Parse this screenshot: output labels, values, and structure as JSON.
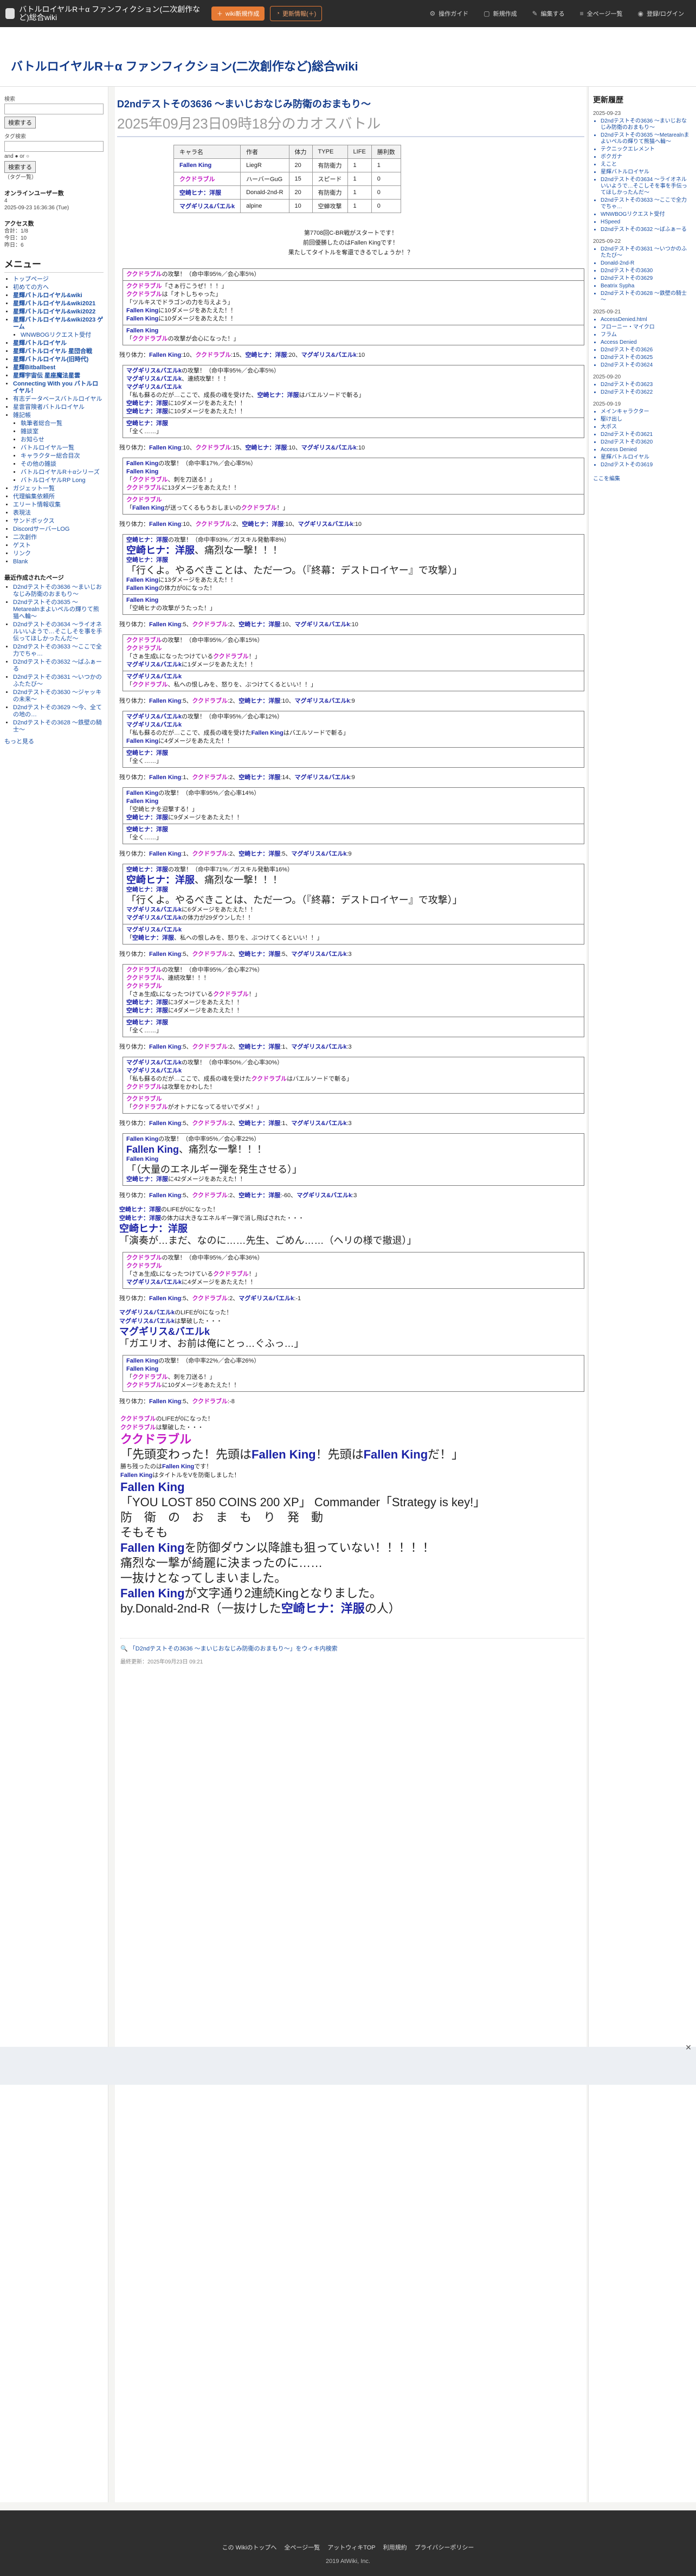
{
  "topbar": {
    "title": "バトルロイヤルR＋α ファンフィクション(二次創作など)総合wiki",
    "btn_wiki": "wiki新規作成",
    "btn_update": "更新情報(＋)",
    "menu": [
      {
        "icon": "gear-icon",
        "label": "操作ガイド"
      },
      {
        "icon": "file-icon",
        "label": "新規作成"
      },
      {
        "icon": "pencil-icon",
        "label": "編集する"
      },
      {
        "icon": "list-icon",
        "label": "全ページ一覧"
      },
      {
        "icon": "user-icon",
        "label": "登録/ログイン"
      }
    ]
  },
  "header": {
    "title": "バトルロイヤルR＋α ファンフィクション(二次創作など)総合wiki"
  },
  "left": {
    "search_label": "検索",
    "search_btn": "検索する",
    "search2_label": "タグ検索",
    "search2_hint": "and ● or ○",
    "search2_btn": "検索する",
    "tag_hint": "（タグ一覧）",
    "online_label": "オンラインユーザー数",
    "online_count": "4",
    "online_date": "2025-09-23 16:36:36 (Tue)",
    "access_label": "アクセス数",
    "access": [
      "合計：1/8",
      "今日：10",
      "昨日：6"
    ],
    "menu_title": "メニュー",
    "menu": [
      {
        "t": "トップページ",
        "b": false,
        "s": false
      },
      {
        "t": "初めての方へ",
        "b": false,
        "s": false
      },
      {
        "t": "星輝バトルロイヤル&wiki",
        "b": true,
        "s": false
      },
      {
        "t": "星輝バトルロイヤル&wiki2021",
        "b": true,
        "s": false
      },
      {
        "t": "星輝バトルロイヤル&wiki2022",
        "b": true,
        "s": false
      },
      {
        "t": "星輝バトルロイヤル&wiki2023 ゲーム",
        "b": true,
        "s": false
      },
      {
        "t": "WNWBOGリクエスト受付",
        "b": false,
        "s": true
      },
      {
        "t": "星輝バトルロイヤル",
        "b": true,
        "s": false
      },
      {
        "t": "星輝バトルロイヤル 星団合戦",
        "b": true,
        "s": false
      },
      {
        "t": "星輝バトルロイヤル(旧時代)",
        "b": true,
        "s": false
      },
      {
        "t": "星輝Bitballbest",
        "b": true,
        "s": false
      },
      {
        "t": "星輝宇宙伝 星座魔法星雲",
        "b": true,
        "s": false
      },
      {
        "t": "Connecting With you バトルロイヤル！",
        "b": true,
        "s": false
      },
      {
        "t": "有志データベースバトルロイヤル",
        "b": false,
        "s": false
      },
      {
        "t": "星雲冒険者バトルロイヤル",
        "b": false,
        "s": false
      },
      {
        "t": "雑記帳",
        "b": false,
        "s": false
      },
      {
        "t": "執筆者総合一覧",
        "b": false,
        "s": true
      },
      {
        "t": "雑談室",
        "b": false,
        "s": true
      },
      {
        "t": "お知らせ",
        "b": false,
        "s": true
      },
      {
        "t": "バトルロイヤル一覧",
        "b": false,
        "s": true
      },
      {
        "t": "キャラクター総合目次",
        "b": false,
        "s": true
      },
      {
        "t": "その他の雑談",
        "b": false,
        "s": true
      },
      {
        "t": "バトルロイヤルR＋αシリーズ",
        "b": false,
        "s": true
      },
      {
        "t": "バトルロイヤルRP Long",
        "b": false,
        "s": true
      },
      {
        "t": "ガジェット一覧",
        "b": false,
        "s": false
      },
      {
        "t": "代理編集依頼所",
        "b": false,
        "s": false
      },
      {
        "t": "エリート情報収集",
        "b": false,
        "s": false
      },
      {
        "t": "表現法",
        "b": false,
        "s": false
      },
      {
        "t": "サンドボックス",
        "b": false,
        "s": false
      },
      {
        "t": "DiscordサーバーLOG",
        "b": false,
        "s": false
      },
      {
        "t": "二次創作",
        "b": false,
        "s": false
      },
      {
        "t": "ゲスト",
        "b": false,
        "s": false
      },
      {
        "t": "リンク",
        "b": false,
        "s": false
      },
      {
        "t": "Blank",
        "b": false,
        "s": false
      }
    ],
    "recent_title": "最近作成されたページ",
    "recent": [
      "D2ndテストその3636 ～まいじおなじみ防衛のおまもり～",
      "D2ndテストその3635 ～Metarealnまよいペルの輝りて熊猫へ輪～",
      "D2ndテストその3634 ～ライオネルいいようで…そこしそを事を手伝ってほしかったんだ～",
      "D2ndテストその3633 ～ここで全力でちゃ…",
      "D2ndテストその3632 ～ばふぁーる",
      "D2ndテストその3631 ～いつかのふたたび～",
      "D2ndテストその3630 ～ジャッキの未来～",
      "D2ndテストその3629 ～今、全ての地の…",
      "D2ndテストその3628 ～鉄壁の騎士～"
    ],
    "more": "もっと見る"
  },
  "main": {
    "title": "D2ndテストその3636 ～まいじおなじみ防衛のおまもり～",
    "subtitle": "2025年09月23日09時18分のカオスバトル",
    "table_headers": [
      "キャラ名",
      "作者",
      "体力",
      "TYPE",
      "LIFE",
      "勝利数"
    ],
    "table_rows": [
      [
        "Fallen King",
        "LiegR",
        "20",
        "有防衛力",
        "1",
        "1"
      ],
      [
        "ククドラブル",
        "ハーバーGuG",
        "15",
        "スピード",
        "1",
        "0"
      ],
      [
        "空崎ヒナ：洋服",
        "Donald-2nd-R",
        "20",
        "有防衛力",
        "1",
        "0"
      ],
      [
        "マグギリス&バエルk",
        "alpine",
        "10",
        "空蝉攻撃",
        "1",
        "0"
      ]
    ],
    "intro": [
      "第7708回C-BR戦がスタートです！",
      "前回優勝したのはFallen Kingです！",
      "果たしてタイトルを奪還できるでしょうか！？"
    ],
    "rounds": [
      {
        "box": [
          [
            "ククドラブルの攻撃！（命中率95%／会心率5%）"
          ],
          [
            "ククドラブル「さぁ行こうぜ！！！」",
            "ククドラブルは「オトしちゃった」",
            "「ツルキスでドラゴンの力を与えよう」",
            "Fallen Kingに10ダメージをあたえた！！",
            "Fallen Kingに10ダメージをあたえた！！"
          ],
          [
            "Fallen King",
            "「ククドラブルの攻撃が会心になった！」"
          ]
        ],
        "tr": "残り体力：Fallen King:10、ククドラブル:15、空崎ヒナ：洋服:20、マグギリス&バエルk:10"
      },
      {
        "box": [
          [
            "マグギリス&バエルkの攻撃！（命中率95%／会心率5%）",
            "マグギリス&バエルk、連続攻撃！！！",
            "マグギリス&バエルk",
            "「私も蘇るのだが…ここで、成長の魂を受けた、空崎ヒナ：洋服はバエルソードで斬る」",
            "空崎ヒナ：洋服に10ダメージをあたえた！！",
            "空崎ヒナ：洋服に10ダメージをあたえた！！"
          ],
          [
            "空崎ヒナ：洋服",
            "「全く……」"
          ]
        ],
        "tr": "残り体力：Fallen King:10、ククドラブル:15、空崎ヒナ：洋服:10、マグギリス&バエルk:10"
      },
      {
        "box": [
          [
            "Fallen Kingの攻撃！（命中率17%／会心率5%）",
            "Fallen King",
            "「ククドラブル、刺を刀送る！」",
            "ククドラブルに13ダメージをあたえた！！"
          ],
          [
            "ククドラブル",
            "「Fallen Kingが送ってくるもうおしまいのククドラブル！」"
          ]
        ],
        "tr": "残り体力：Fallen King:10、ククドラブル:2、空崎ヒナ：洋服:10、マグギリス&バエルk:10"
      },
      {
        "box": [
          [
            "空崎ヒナ：洋服の攻撃！（命中率93%／ガスキル発動率8%）",
            "空崎ヒナ：洋服、痛烈な一撃！！！",
            "空崎ヒナ：洋服",
            "「行くよ。やるべきことは、ただ一つ。（『終幕：デストロイヤー』で攻撃）」",
            "Fallen Kingに13ダメージをあたえた！！",
            "Fallen Kingの体力が0になった！"
          ],
          [
            "Fallen King",
            "「空崎ヒナの攻撃がうたった！」"
          ]
        ],
        "tr": "残り体力：Fallen King:5、ククドラブル:2、空崎ヒナ：洋服:10、マグギリス&バエルk:10"
      },
      {
        "box": [
          [
            "ククドラブルの攻撃！（命中率95%／会心率15%）",
            "ククドラブル",
            "「さぁ生成Lになったつけているククドラブル！」",
            "マグギリス&バエルkに1ダメージをあたえた！！"
          ],
          [
            "マグギリス&バエルk",
            "「ククドラブル、私への恨しみを、怒りを、ぶつけてくるといい！！」"
          ]
        ],
        "tr": "残り体力：Fallen King:5、ククドラブル:2、空崎ヒナ：洋服:10、マグギリス&バエルk:9"
      },
      {
        "box": [
          [
            "マグギリス&バエルkの攻撃！（命中率95%／会心率12%）",
            "マグギリス&バエルk",
            "「私も蘇るのだが…ここで、成長の魂を受けたFallen Kingはバエルソードで斬る」",
            "Fallen Kingに4ダメージをあたえた！！"
          ],
          [
            "空崎ヒナ：洋服",
            "「全く……」"
          ]
        ],
        "tr": "残り体力：Fallen King:1、ククドラブル:2、空崎ヒナ：洋服:14、マグギリス&バエルk:9"
      },
      {
        "box": [
          [
            "Fallen Kingの攻撃！（命中率95%／会心率14%）",
            "Fallen King",
            "「空崎ヒナを迎撃する！」",
            "空崎ヒナ：洋服に9ダメージをあたえた！！"
          ],
          [
            "空崎ヒナ：洋服",
            "「全く……」"
          ]
        ],
        "tr": "残り体力：Fallen King:1、ククドラブル:2、空崎ヒナ：洋服:5、マグギリス&バエルk:9"
      },
      {
        "box": [
          [
            "空崎ヒナ：洋服の攻撃！（命中率71%／ガスキル発動率16%）",
            "空崎ヒナ：洋服、痛烈な一撃！！！",
            "空崎ヒナ：洋服",
            "「行くよ。やるべきことは、ただ一つ。（『終幕：デストロイヤー』で攻撃）」",
            "マグギリス&バエルkに6ダメージをあたえた！！",
            "マグギリス&バエルkの体力が29ダウンした！！"
          ],
          [
            "マグギリス&バエルk",
            "「空崎ヒナ：洋服、私への恨しみを、怒りを、ぶつけてくるといい！！」"
          ]
        ],
        "tr": "残り体力：Fallen King:5、ククドラブル:2、空崎ヒナ：洋服:5、マグギリス&バエルk:3"
      },
      {
        "box": [
          [
            "ククドラブルの攻撃！（命中率95%／会心率27%）",
            "ククドラブル、連続攻撃！！！",
            "ククドラブル",
            "「さぁ生成Lになったつけているククドラブル！」",
            "空崎ヒナ：洋服に3ダメージをあたえた！！",
            "空崎ヒナ：洋服に4ダメージをあたえた！！"
          ],
          [
            "空崎ヒナ：洋服",
            "「全く……」"
          ]
        ],
        "tr": "残り体力：Fallen King:5、ククドラブル:2、空崎ヒナ：洋服:1、マグギリス&バエルk:3"
      },
      {
        "box": [
          [
            "マグギリス&バエルkの攻撃！（命中率50%／会心率30%）",
            "マグギリス&バエルk",
            "「私も蘇るのだが…ここで、成長の魂を受けたククドラブルはバエルソードで斬る」",
            "ククドラブルは攻撃をかわした！"
          ],
          [
            "ククドラブル",
            "「ククドラブルがオトナになってるせいでダメ！」"
          ]
        ],
        "tr": "残り体力：Fallen King:5、ククドラブル:2、空崎ヒナ：洋服:1、マグギリス&バエルk:3"
      },
      {
        "box": [
          [
            "Fallen Kingの攻撃！（命中率95%／会心率22%）",
            "Fallen King、痛烈な一撃！！！",
            "Fallen King",
            "「（大量のエネルギー弾を発生させる）」",
            "空崎ヒナ：洋服に42ダメージをあたえた！！"
          ]
        ],
        "tr": "残り体力：Fallen King:5、ククドラブル:2、空崎ヒナ：洋服:-60、マグギリス&バエルk:3"
      },
      {
        "free": [
          "空崎ヒナ：洋服のLIFEが0になった！",
          "空崎ヒナ：洋服の体力は大きなエネルギー弾で消し飛ばされた・・・",
          "空崎ヒナ：洋服",
          "「演奏が…まだ、なのに……先生、ごめん……（ヘリの様で撤退）」"
        ]
      },
      {
        "box": [
          [
            "ククドラブルの攻撃！（命中率95%／会心率36%）",
            "ククドラブル",
            "「さぁ生成Lになったつけているククドラブル！」",
            "マグギリス&バエルkに4ダメージをあたえた！！"
          ]
        ],
        "tr": "残り体力：Fallen King:5、ククドラブル:2、マグギリス&バエルk:-1"
      },
      {
        "free": [
          "マグギリス&バエルkのLIFEが0になった！",
          "マグギリス&バエルkは撃破した・・・",
          "マグギリス&バエルk",
          "「ガエリオ、お前は俺にとっ…ぐふっ…」"
        ]
      },
      {
        "box": [
          [
            "Fallen Kingの攻撃！（命中率22%／会心率26%）",
            "Fallen King",
            "「ククドラブル、刺を刀送る！」",
            "ククドラブルに10ダメージをあたえた！！"
          ]
        ],
        "tr": "残り体力：Fallen King:5、ククドラブル:-8"
      }
    ],
    "finale": [
      "ククドラブルのLIFEが0になった！",
      "ククドラブルは撃破した・・・",
      "ククドラブル",
      "「先頭変わった！先頭はFallen King！先頭はFallen Kingだ！」",
      "勝ち残ったのはFallen Kingです！",
      "Fallen KingはタイトルをVを防衛しました！",
      "Fallen King",
      "「YOU LOST 850 COINS 200 XP」 Commander「Strategy is key!」",
      "防　衛　の　お　ま　も　り　発　動",
      "そもそも",
      "Fallen Kingを防御ダウン以降誰も狙っていない！！！！！",
      "痛烈な一撃が綺麗に決まったのに……",
      "一抜けとなってしまいました。",
      "Fallen Kingが文字通り2連続Kingとなりました。",
      "by.Donald-2nd-R（一抜けした空崎ヒナ：洋服の人）"
    ],
    "page_link": "「D2ndテストその3636 ～まいじおなじみ防衛のおまもり～」をウィキ内検索",
    "updated": "最終更新：2025年09月23日 09:21"
  },
  "right": {
    "title": "更新履歴",
    "groups": [
      {
        "date": "2025-09-23",
        "items": [
          "D2ndテストその3636 ～まいじおなじみ防衛のおまもり～",
          "D2ndテストその3635 ～Metarealnまよいペルの輝りて熊猫へ輪～",
          "テクニックエレメント",
          "ボクガナ",
          "えこと",
          "星輝バトルロイヤル",
          "D2ndテストその3634 ～ライオネルいいようで…そこしそを事を手伝ってほしかったんだ～",
          "D2ndテストその3633 ～ここで全力でちゃ…",
          "WNWBOGリクエスト受付",
          "HSpeed",
          "D2ndテストその3632 ～ばふぁーる"
        ]
      },
      {
        "date": "2025-09-22",
        "items": [
          "D2ndテストその3631 ～いつかのふたたび～",
          "Donald-2nd-R",
          "D2ndテストその3630",
          "D2ndテストその3629",
          "Beatrix Sypha",
          "D2ndテストその3628 ～鉄壁の騎士～"
        ]
      },
      {
        "date": "2025-09-21",
        "items": [
          "AccessDenied.html",
          "フローニー・マイクロ",
          "フラム",
          "Access Denied",
          "D2ndテストその3626",
          "D2ndテストその3625",
          "D2ndテストその3624"
        ]
      },
      {
        "date": "2025-09-20",
        "items": [
          "D2ndテストその3623",
          "D2ndテストその3622"
        ]
      },
      {
        "date": "2025-09-19",
        "items": [
          "メインキャラクター",
          "駆け出し",
          "大ボス",
          "D2ndテストその3621",
          "D2ndテストその3620",
          "Access Denied",
          "星輝バトルロイヤル",
          "D2ndテストその3619"
        ]
      }
    ],
    "more": "ここを編集"
  },
  "footer": {
    "links": [
      "この Wikiのトップへ",
      "全ページ一覧",
      "アットウィキTOP",
      "利用規約",
      "プライバシーポリシー"
    ],
    "copy": "2019 AtWiki, Inc."
  }
}
